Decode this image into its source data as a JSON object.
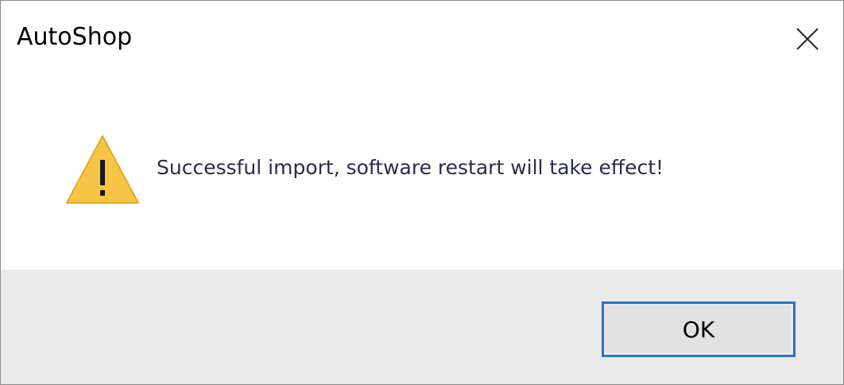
{
  "dialog": {
    "title": "AutoShop",
    "message": "Successful import, software restart will take effect!",
    "icon": "warning-icon",
    "ok_label": "OK"
  },
  "colors": {
    "warning_fill": "#f7c546",
    "accent_border": "#2f74c0",
    "footer_bg": "#eaeaea"
  }
}
